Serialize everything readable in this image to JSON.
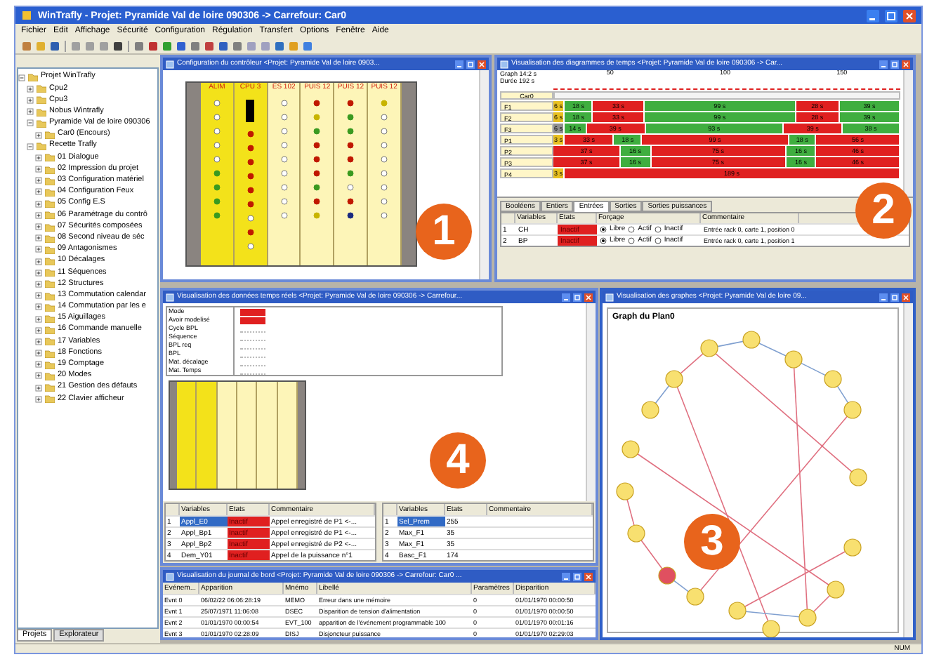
{
  "window": {
    "title": "WinTrafly - Projet: Pyramide Val de loire 090306 -> Carrefour: Car0"
  },
  "menu": [
    "Fichier",
    "Edit",
    "Affichage",
    "Sécurité",
    "Configuration",
    "Régulation",
    "Transfert",
    "Options",
    "Fenêtre",
    "Aide"
  ],
  "project_tree": {
    "items": [
      {
        "label": "Projet WinTrafly",
        "expanded": true,
        "children": [
          {
            "label": "Cpu2",
            "expanded": false
          },
          {
            "label": "Cpu3",
            "expanded": false
          },
          {
            "label": "Nobus Wintrafly",
            "expanded": false
          },
          {
            "label": "Pyramide Val de loire 090306",
            "expanded": true,
            "children": [
              {
                "label": "Car0 (Encours)",
                "expanded": false
              }
            ]
          },
          {
            "label": "Recette Trafly",
            "expanded": true,
            "children": [
              {
                "label": "01 Dialogue",
                "expanded": false
              },
              {
                "label": "02 Impression du projet",
                "expanded": false
              },
              {
                "label": "03 Configuration matériel",
                "expanded": false
              },
              {
                "label": "04 Configuration Feux",
                "expanded": false
              },
              {
                "label": "05 Config E.S",
                "expanded": false
              },
              {
                "label": "06 Paramétrage du contrô",
                "expanded": false
              },
              {
                "label": "07 Sécurités composées",
                "expanded": false
              },
              {
                "label": "08 Second niveau de séc",
                "expanded": false
              },
              {
                "label": "09 Antagonismes",
                "expanded": false
              },
              {
                "label": "10 Décalages",
                "expanded": false
              },
              {
                "label": "11 Séquences",
                "expanded": false
              },
              {
                "label": "12 Structures",
                "expanded": false
              },
              {
                "label": "13 Commutation calendar",
                "expanded": false
              },
              {
                "label": "14 Commutation par les e",
                "expanded": false
              },
              {
                "label": "15 Aiguillages",
                "expanded": false
              },
              {
                "label": "16 Commande manuelle",
                "expanded": false
              },
              {
                "label": "17 Variables",
                "expanded": false
              },
              {
                "label": "18 Fonctions",
                "expanded": false
              },
              {
                "label": "19 Comptage",
                "expanded": false
              },
              {
                "label": "20 Modes",
                "expanded": false
              },
              {
                "label": "21 Gestion des défauts",
                "expanded": false
              },
              {
                "label": "22 Clavier afficheur",
                "expanded": false
              }
            ]
          }
        ]
      }
    ],
    "bottom_tabs": [
      {
        "label": "Projets",
        "selected": true
      },
      {
        "label": "Explorateur",
        "selected": false
      }
    ]
  },
  "controller_window": {
    "title": "Configuration du contrôleur <Projet: Pyramide Val de loire 0903...",
    "callout": "1",
    "modules": [
      {
        "label": "ALIM",
        "kind": "alim",
        "leds": [
          {
            "color": "#ffffff"
          },
          {
            "color": "#ffffff"
          },
          {
            "color": "#ffffff"
          },
          {
            "color": "#ffffff"
          },
          {
            "color": "#ffffff"
          },
          {
            "color": "#3a9a20"
          },
          {
            "color": "#3a9a20"
          },
          {
            "color": "#3a9a20"
          },
          {
            "color": "#3a9a20"
          }
        ]
      },
      {
        "label": "CPU 3",
        "kind": "cpu",
        "leds": [
          {
            "color": "#c01800"
          },
          {
            "color": "#c01800"
          },
          {
            "color": "#c01800"
          },
          {
            "color": "#c01800"
          },
          {
            "color": "#c01800"
          },
          {
            "color": "#c01800"
          },
          {
            "color": "#ffffff"
          },
          {
            "color": "#c01800"
          },
          {
            "color": "#ffffff"
          }
        ]
      },
      {
        "label": "ES 102",
        "kind": "io",
        "leds": [
          {
            "color": "#ffffff"
          },
          {
            "color": "#ffffff"
          },
          {
            "color": "#ffffff"
          },
          {
            "color": "#ffffff"
          },
          {
            "color": "#ffffff"
          },
          {
            "color": "#ffffff"
          },
          {
            "color": "#ffffff"
          },
          {
            "color": "#ffffff"
          },
          {
            "color": "#ffffff"
          }
        ]
      },
      {
        "label": "PUIS 12",
        "kind": "power",
        "leds": [
          {
            "color": "#c01800"
          },
          {
            "color": "#c8b400"
          },
          {
            "color": "#3a9a20"
          },
          {
            "color": "#c01800"
          },
          {
            "color": "#c01800"
          },
          {
            "color": "#c01800"
          },
          {
            "color": "#3a9a20"
          },
          {
            "color": "#c01800"
          },
          {
            "color": "#c8b400"
          }
        ]
      },
      {
        "label": "PUIS 12",
        "kind": "power",
        "leds": [
          {
            "color": "#c01800"
          },
          {
            "color": "#3a9a20"
          },
          {
            "color": "#3a9a20"
          },
          {
            "color": "#c01800"
          },
          {
            "color": "#c01800"
          },
          {
            "color": "#3a9a20"
          },
          {
            "color": "#ffffff"
          },
          {
            "color": "#c01800"
          },
          {
            "color": "#1a2a80"
          }
        ]
      },
      {
        "label": "PUIS 12",
        "kind": "power",
        "leds": [
          {
            "color": "#c8b400"
          },
          {
            "color": "#ffffff"
          },
          {
            "color": "#ffffff"
          },
          {
            "color": "#ffffff"
          },
          {
            "color": "#ffffff"
          },
          {
            "color": "#ffffff"
          },
          {
            "color": "#ffffff"
          },
          {
            "color": "#ffffff"
          },
          {
            "color": "#ffffff"
          }
        ]
      }
    ]
  },
  "timeline_window": {
    "title": "Visualisation des diagrammes de temps <Projet: Pyramide Val de loire 090306 -> Car...",
    "callout": "2",
    "info": [
      "Graph  14:2 s",
      "Durée 192 s"
    ],
    "ticks": [
      "50",
      "100",
      "150"
    ],
    "header_label": "Car0",
    "rows": [
      {
        "label": "F1",
        "segments": [
          {
            "color": "#e8c020",
            "text": "6 s"
          },
          {
            "color": "#3fae3f",
            "text": "18 s"
          },
          {
            "color": "#e02020",
            "text": "33 s"
          },
          {
            "color": "#3fae3f",
            "text": "99 s"
          },
          {
            "color": "#e02020",
            "text": "28 s"
          },
          {
            "color": "#3fae3f",
            "text": "39 s"
          }
        ]
      },
      {
        "label": "F2",
        "segments": [
          {
            "color": "#e8c020",
            "text": "6 s"
          },
          {
            "color": "#3fae3f",
            "text": "18 s"
          },
          {
            "color": "#e02020",
            "text": "33 s"
          },
          {
            "color": "#3fae3f",
            "text": "99 s"
          },
          {
            "color": "#e02020",
            "text": "28 s"
          },
          {
            "color": "#3fae3f",
            "text": "39 s"
          }
        ]
      },
      {
        "label": "F3",
        "segments": [
          {
            "color": "#909090",
            "text": "6 s"
          },
          {
            "color": "#3fae3f",
            "text": "14 s"
          },
          {
            "color": "#e02020",
            "text": "39 s"
          },
          {
            "color": "#3fae3f",
            "text": "93 s"
          },
          {
            "color": "#e02020",
            "text": "39 s"
          },
          {
            "color": "#3fae3f",
            "text": "38 s"
          }
        ]
      },
      {
        "label": "P1",
        "segments": [
          {
            "color": "#e8c020",
            "text": "3 s"
          },
          {
            "color": "#e02020",
            "text": "33 s"
          },
          {
            "color": "#3fae3f",
            "text": "18 s"
          },
          {
            "color": "#e02020",
            "text": "99 s"
          },
          {
            "color": "#3fae3f",
            "text": "18 s"
          },
          {
            "color": "#e02020",
            "text": "56 s"
          }
        ]
      },
      {
        "label": "P2",
        "segments": [
          {
            "color": "#e02020",
            "text": "37 s"
          },
          {
            "color": "#3fae3f",
            "text": "16 s"
          },
          {
            "color": "#e02020",
            "text": "75 s"
          },
          {
            "color": "#3fae3f",
            "text": "16 s"
          },
          {
            "color": "#e02020",
            "text": "46 s"
          }
        ]
      },
      {
        "label": "P3",
        "segments": [
          {
            "color": "#e02020",
            "text": "37 s"
          },
          {
            "color": "#3fae3f",
            "text": "16 s"
          },
          {
            "color": "#e02020",
            "text": "75 s"
          },
          {
            "color": "#3fae3f",
            "text": "16 s"
          },
          {
            "color": "#e02020",
            "text": "46 s"
          }
        ]
      },
      {
        "label": "P4",
        "segments": [
          {
            "color": "#e8c020",
            "text": "3 s"
          },
          {
            "color": "#e02020",
            "text": "189 s"
          }
        ]
      }
    ],
    "tabs": [
      {
        "label": "Booléens",
        "selected": false
      },
      {
        "label": "Entiers",
        "selected": false
      },
      {
        "label": "Entrées",
        "selected": true
      },
      {
        "label": "Sorties",
        "selected": false
      },
      {
        "label": "Sorties puissances",
        "selected": false
      }
    ],
    "table": {
      "columns": [
        "Variables",
        "Etats",
        "Forçage",
        "Commentaire"
      ],
      "rows": [
        {
          "index": "1",
          "variable": "CH",
          "state": "Inactif",
          "options": [
            {
              "label": "Libre",
              "selected": true
            },
            {
              "label": "Actif",
              "selected": false
            },
            {
              "label": "Inactif",
              "selected": false
            }
          ],
          "comment": "Entrée rack 0, carte 1, position 0"
        },
        {
          "index": "2",
          "variable": "BP",
          "state": "Inactif",
          "options": [
            {
              "label": "Libre",
              "selected": true
            },
            {
              "label": "Actif",
              "selected": false
            },
            {
              "label": "Inactif",
              "selected": false
            }
          ],
          "comment": "Entrée rack 0, carte 1, position 1"
        }
      ]
    }
  },
  "realtime_window": {
    "title": "Visualisation des données temps réels <Projet: Pyramide Val de loire 090306 -> Carrefour...",
    "callout": "4",
    "indicators": [
      {
        "label": "Mode",
        "active": true
      },
      {
        "label": "Avoir modelisé",
        "active": true
      },
      {
        "label": "Cycle BPL",
        "active": false
      },
      {
        "label": "Séquence",
        "active": false
      },
      {
        "label": "BPL req",
        "active": false
      },
      {
        "label": "BPL",
        "active": false
      },
      {
        "label": "Mat. décalage",
        "active": false
      },
      {
        "label": "Mat. Temps",
        "active": false
      }
    ],
    "left_table": {
      "columns": [
        "Variables",
        "Etats",
        "Commentaire"
      ],
      "rows": [
        {
          "index": "1",
          "variable": "Appl_E0",
          "state": "Inactif",
          "comment": "Appel enregistré de P1 <-...",
          "selected": true
        },
        {
          "index": "2",
          "variable": "Appl_Bp1",
          "state": "Inactif",
          "comment": "Appel enregistré de P1 <-...",
          "selected": false
        },
        {
          "index": "3",
          "variable": "Appl_Bp2",
          "state": "Inactif",
          "comment": "Appel enregistré de P2 <-...",
          "selected": false
        },
        {
          "index": "4",
          "variable": "Dem_Y01",
          "state": "Inactif",
          "comment": "Appel de la puissance n°1",
          "selected": false
        }
      ]
    },
    "right_table": {
      "columns": [
        "Variables",
        "Etats",
        "Commentaire"
      ],
      "rows": [
        {
          "index": "1",
          "variable": "Sel_Prem",
          "state": "255",
          "selected": true
        },
        {
          "index": "2",
          "variable": "Max_F1",
          "state": "35",
          "selected": false
        },
        {
          "index": "3",
          "variable": "Max_F1",
          "state": "35",
          "selected": false
        },
        {
          "index": "4",
          "variable": "Basc_F1",
          "state": "174",
          "selected": false
        }
      ]
    }
  },
  "graph_window": {
    "title": "Visualisation des graphes <Projet: Pyramide Val de loire 09...",
    "graph_title": "Graph du Plan0",
    "callout": "3",
    "nodes": [
      {
        "active": false
      },
      {
        "active": false
      },
      {
        "active": false
      },
      {
        "active": false
      },
      {
        "active": false
      },
      {
        "active": false
      },
      {
        "active": false
      },
      {
        "active": false
      },
      {
        "active": false
      },
      {
        "active": false
      },
      {
        "active": false
      },
      {
        "active": false
      },
      {
        "active": true
      },
      {
        "active": false
      },
      {
        "active": false
      },
      {
        "active": false
      },
      {
        "active": false
      },
      {
        "active": false
      }
    ]
  },
  "journal_window": {
    "title": "Visualisation du journal de bord <Projet: Pyramide Val de loire 090306 -> Carrefour: Car0 ...",
    "columns": [
      "Evénem...",
      "Apparition",
      "Mnémo",
      "Libellé",
      "Paramètres",
      "Disparition"
    ],
    "rows": [
      [
        "Evnt 0",
        "06/02/22 06:06:28:19",
        "MEMO",
        "Erreur dans une mémoire",
        "0",
        "01/01/1970 00:00:50"
      ],
      [
        "Evnt 1",
        "25/07/1971 11:06:08",
        "DSEC",
        "Disparition de tension d'alimentation",
        "0",
        "01/01/1970 00:00:50"
      ],
      [
        "Evnt 2",
        "01/01/1970 00:00:54",
        "EVT_100",
        "apparition de l'événement programmable 100",
        "0",
        "01/01/1970 00:01:16"
      ],
      [
        "Evnt 3",
        "01/01/1970 02:28:09",
        "DISJ",
        "Disjoncteur puissance",
        "0",
        "01/01/1970 02:29:03"
      ]
    ]
  },
  "status_bar": {
    "right": "NUM"
  }
}
